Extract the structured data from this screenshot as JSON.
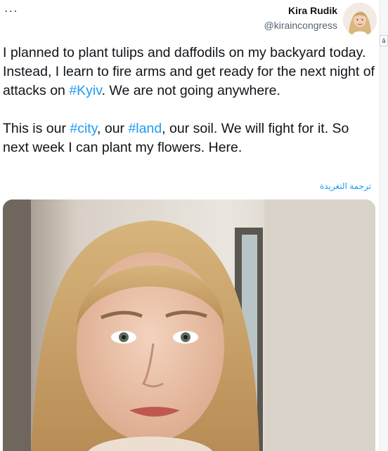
{
  "toolbar": {
    "more_label": "..."
  },
  "author": {
    "name": "Kira Rudik",
    "handle": "@kiraincongress"
  },
  "tweet": {
    "p1_before": "I planned to plant tulips and daffodils on my backyard today. Instead, I learn to fire arms and get ready for the next night of attacks on ",
    "p1_tag": "#Kyiv",
    "p1_after": ". We are not going anywhere.",
    "p2_a": "This is our ",
    "p2_tag1": "#city",
    "p2_b": ", our ",
    "p2_tag2": "#land",
    "p2_c": ", our soil. We will fight for it. So next week I can plant my flowers. Here."
  },
  "translate_label": "ترجمة التغريدة",
  "scroll_badge": "ā",
  "colors": {
    "link": "#1d9bf0",
    "text": "#0f1419",
    "muted": "#536471"
  }
}
